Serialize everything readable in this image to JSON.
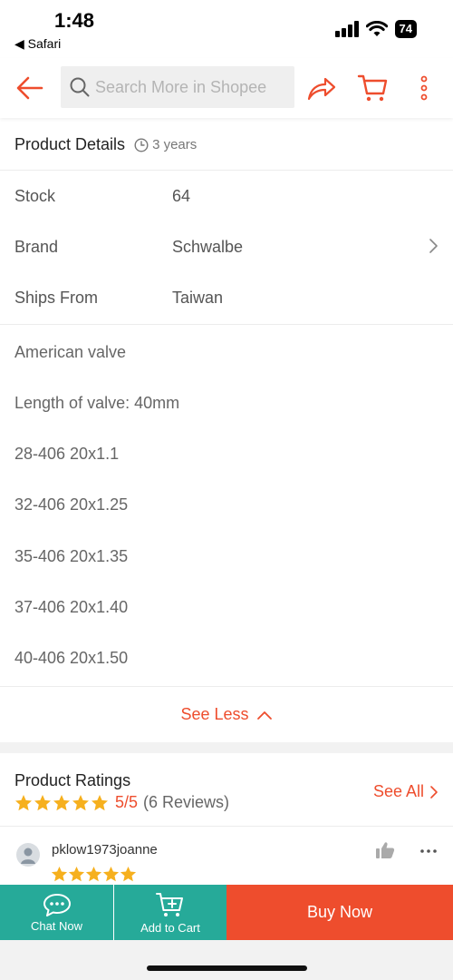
{
  "status_bar": {
    "time": "1:48",
    "back_app": "◀ Safari",
    "battery": "74"
  },
  "nav": {
    "search_placeholder": "Search More in Shopee",
    "accent_color": "#ee4d2d"
  },
  "product_details": {
    "title": "Product Details",
    "age": "3 years",
    "specs": [
      {
        "label": "Stock",
        "value": "64"
      },
      {
        "label": "Brand",
        "value": "Schwalbe"
      },
      {
        "label": "Ships From",
        "value": "Taiwan"
      }
    ],
    "description": [
      "American valve",
      "Length of valve: 40mm",
      "28-406 20x1.1",
      "32-406 20x1.25",
      "35-406 20x1.35",
      "37-406 20x1.40",
      "40-406 20x1.50"
    ],
    "see_less": "See Less"
  },
  "ratings": {
    "title": "Product Ratings",
    "stars": 5,
    "score": "5/5",
    "count": "(6 Reviews)",
    "see_all": "See All",
    "star_color": "#f6b01e"
  },
  "review": {
    "username": "pklow1973joanne",
    "stars": 5
  },
  "bottom_bar": {
    "chat": "Chat Now",
    "add_to_cart": "Add to Cart",
    "buy_now": "Buy Now",
    "teal_color": "#26aa99"
  }
}
